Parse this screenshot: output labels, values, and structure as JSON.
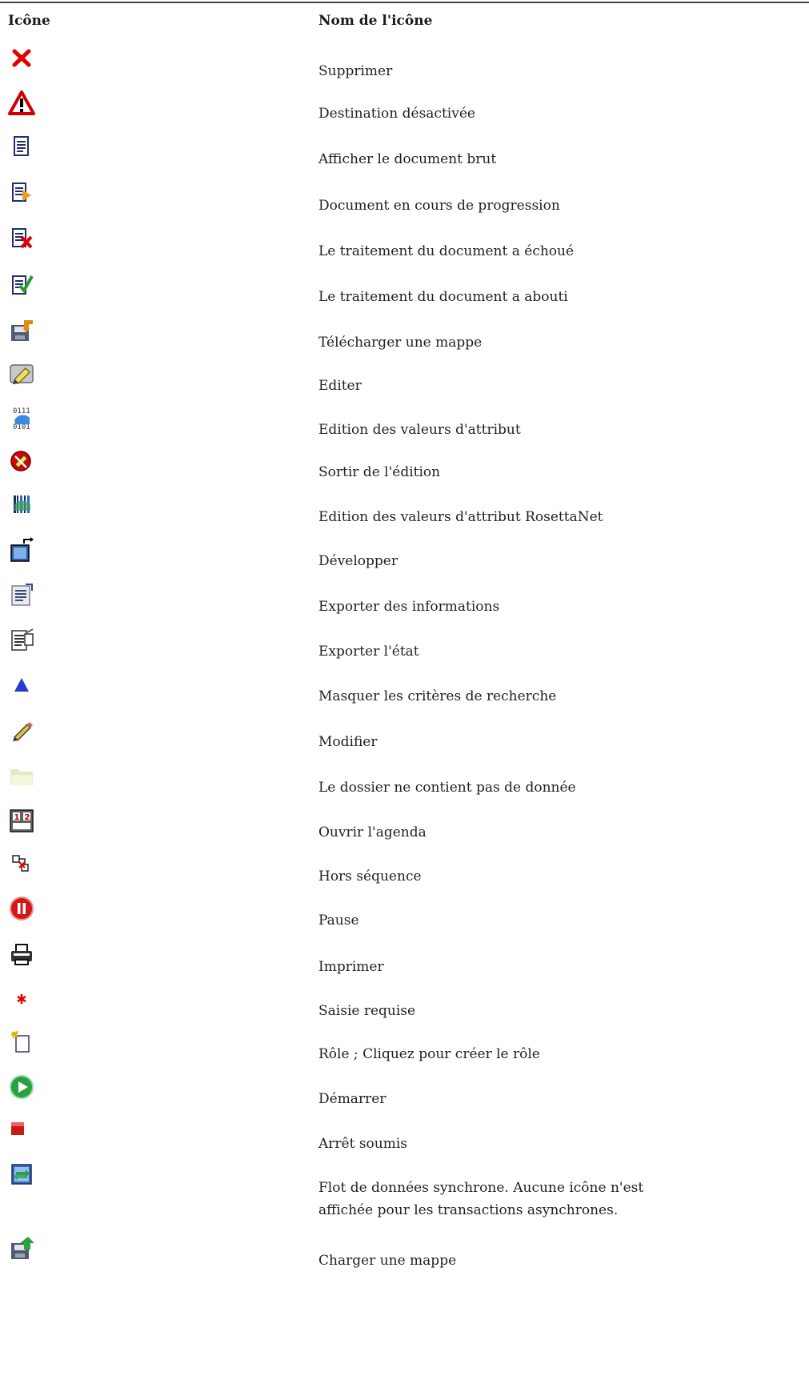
{
  "header": {
    "col_icon": "Icône",
    "col_name": "Nom de l'icône"
  },
  "rows": [
    {
      "icon": "delete-x-icon",
      "label": "Supprimer"
    },
    {
      "icon": "warning-triangle-icon",
      "label": "Destination désactivée"
    },
    {
      "icon": "document-icon",
      "label": "Afficher le document brut"
    },
    {
      "icon": "document-progress-icon",
      "label": "Document en cours de progression"
    },
    {
      "icon": "document-failed-icon",
      "label": "Le traitement du document a échoué"
    },
    {
      "icon": "document-success-icon",
      "label": "Le traitement du document a abouti"
    },
    {
      "icon": "download-map-icon",
      "label": "Télécharger une mappe"
    },
    {
      "icon": "edit-eraser-icon",
      "label": "Editer"
    },
    {
      "icon": "binary-attribute-icon",
      "label": "Edition des valeurs d'attribut"
    },
    {
      "icon": "exit-edit-icon",
      "label": "Sortir de l'édition"
    },
    {
      "icon": "rosettanet-attribute-icon",
      "label": "Edition des valeurs d'attribut RosettaNet"
    },
    {
      "icon": "expand-icon",
      "label": "Développer"
    },
    {
      "icon": "export-info-icon",
      "label": "Exporter des informations"
    },
    {
      "icon": "export-state-icon",
      "label": "Exporter l'état"
    },
    {
      "icon": "hide-triangle-icon",
      "label": "Masquer les critères de recherche"
    },
    {
      "icon": "pencil-icon",
      "label": "Modifier"
    },
    {
      "icon": "empty-folder-icon",
      "label": "Le dossier ne contient pas de donnée"
    },
    {
      "icon": "calendar-icon",
      "label": "Ouvrir l'agenda"
    },
    {
      "icon": "out-of-sequence-icon",
      "label": "Hors séquence"
    },
    {
      "icon": "pause-icon",
      "label": "Pause"
    },
    {
      "icon": "printer-icon",
      "label": "Imprimer"
    },
    {
      "icon": "required-asterisk-icon",
      "label": "Saisie requise"
    },
    {
      "icon": "new-role-icon",
      "label": "Rôle ; Cliquez pour créer le rôle"
    },
    {
      "icon": "start-play-icon",
      "label": "Démarrer"
    },
    {
      "icon": "stop-square-icon",
      "label": "Arrêt soumis"
    },
    {
      "icon": "sync-flow-icon",
      "label": "Flot de données synchrone. Aucune icône n'est",
      "label2": "affichée pour les transactions asynchrones."
    },
    {
      "icon": "upload-map-icon",
      "label": "Charger une mappe"
    }
  ]
}
